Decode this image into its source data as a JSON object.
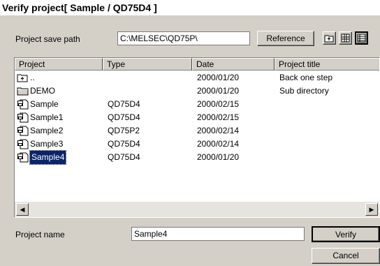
{
  "window": {
    "title": "Verify project[ Sample / QD75D4 ]"
  },
  "save_path": {
    "label": "Project save path",
    "value": "C:\\MELSEC\\QD75P\\",
    "reference_label": "Reference"
  },
  "toolbar_icons": [
    "up-folder-icon",
    "list-view-icon",
    "details-view-icon"
  ],
  "columns": [
    "Project",
    "Type",
    "Date",
    "Project title"
  ],
  "rows": [
    {
      "icon": "parent-folder-icon",
      "name": "..",
      "type": "",
      "date": "2000/01/20",
      "title": "Back one step",
      "selected": false
    },
    {
      "icon": "folder-icon",
      "name": "DEMO",
      "type": "",
      "date": "2000/01/20",
      "title": "Sub directory",
      "selected": false
    },
    {
      "icon": "project-file-icon",
      "name": "Sample",
      "type": "QD75D4",
      "date": "2000/02/15",
      "title": "",
      "selected": false
    },
    {
      "icon": "project-file-icon",
      "name": "Sample1",
      "type": "QD75D4",
      "date": "2000/02/15",
      "title": "",
      "selected": false
    },
    {
      "icon": "project-file-icon",
      "name": "Sample2",
      "type": "QD75P2",
      "date": "2000/02/14",
      "title": "",
      "selected": false
    },
    {
      "icon": "project-file-icon",
      "name": "Sample3",
      "type": "QD75D4",
      "date": "2000/02/14",
      "title": "",
      "selected": false
    },
    {
      "icon": "project-file-icon",
      "name": "Sample4",
      "type": "QD75D4",
      "date": "2000/01/20",
      "title": "",
      "selected": true
    }
  ],
  "project_name": {
    "label": "Project name",
    "value": "Sample4"
  },
  "buttons": {
    "verify": "Verify",
    "cancel": "Cancel"
  },
  "colors": {
    "dialog": "#d4d0c8",
    "selection": "#0a246a"
  }
}
